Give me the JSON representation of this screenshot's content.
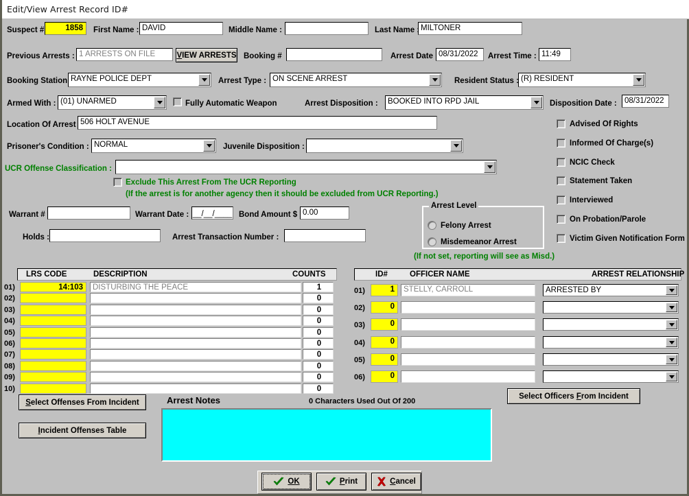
{
  "window": {
    "title": "Edit/View Arrest Record ID#"
  },
  "row_suspect": {
    "suspect_label": "Suspect #",
    "suspect_value": "1858",
    "first_name_label": "First Name :",
    "first_name_value": "DAVID",
    "middle_name_label": "Middle Name :",
    "middle_name_value": "",
    "last_name_label": "Last Name :",
    "last_name_value": "MILTONER"
  },
  "row_prev": {
    "prev_arrests_label": "Previous Arrests :",
    "prev_arrests_value": "1 ARRESTS ON FILE",
    "view_arrests_button": "VIEW ARRESTS",
    "booking_label": "Booking #",
    "booking_value": "",
    "arrest_date_label": "Arrest Date :",
    "arrest_date_value": "08/31/2022",
    "arrest_time_label": "Arrest Time :",
    "arrest_time_value": "11:49"
  },
  "row_booking": {
    "booking_station_label": "Booking Station :",
    "booking_station_value": "RAYNE POLICE DEPT",
    "arrest_type_label": "Arrest Type :",
    "arrest_type_value": "ON SCENE ARREST",
    "resident_status_label": "Resident Status :",
    "resident_status_value": "(R) RESIDENT"
  },
  "row_armed": {
    "armed_with_label": "Armed With :",
    "armed_with_value": "(01) UNARMED",
    "fully_automatic_label": "Fully Automatic Weapon",
    "arrest_disposition_label": "Arrest Disposition :",
    "arrest_disposition_value": "BOOKED INTO  RPD JAIL",
    "disposition_date_label": "Disposition Date :",
    "disposition_date_value": "08/31/2022"
  },
  "row_location": {
    "location_label": "Location Of Arrest :",
    "location_value": "506 HOLT AVENUE"
  },
  "row_condition": {
    "prisoner_condition_label": "Prisoner's Condition :",
    "prisoner_condition_value": "NORMAL",
    "juvenile_disposition_label": "Juvenile Disposition :",
    "juvenile_disposition_value": ""
  },
  "row_ucr": {
    "ucr_label": "UCR Offense Classification :",
    "ucr_value": "",
    "exclude_label": "Exclude This Arrest From The UCR Reporting",
    "exclude_note": "(If the arrest is for another agency then it should be excluded from UCR Reporting.)"
  },
  "row_warrant": {
    "warrant_num_label": "Warrant #",
    "warrant_num_value": "",
    "warrant_date_label": "Warrant Date :",
    "warrant_date_value": "__/__/____",
    "bond_amount_label": "Bond Amount $",
    "bond_amount_value": "0.00",
    "holds_label": "Holds :",
    "holds_value": "",
    "transaction_label": "Arrest Transaction Number :",
    "transaction_value": ""
  },
  "arrest_level": {
    "group_title": "Arrest Level",
    "felony_label": "Felony Arrest",
    "misdemeanor_label": "Misdemeanor Arrest",
    "note": "(If not set, reporting will see as Misd.)"
  },
  "checkboxes": [
    {
      "label": "Advised Of Rights"
    },
    {
      "label": "Informed Of Charge(s)"
    },
    {
      "label": "NCIC Check"
    },
    {
      "label": "Statement Taken"
    },
    {
      "label": "Interviewed"
    },
    {
      "label": "On Probation/Parole"
    },
    {
      "label": "Victim Given Notification Form"
    }
  ],
  "offense_table": {
    "headers": {
      "code": "LRS CODE",
      "description": "DESCRIPTION",
      "counts": "COUNTS"
    },
    "rows": [
      {
        "num": "01)",
        "code": "14:103",
        "description": "DISTURBING THE PEACE",
        "counts": "1"
      },
      {
        "num": "02)",
        "code": "",
        "description": "",
        "counts": "0"
      },
      {
        "num": "03)",
        "code": "",
        "description": "",
        "counts": "0"
      },
      {
        "num": "04)",
        "code": "",
        "description": "",
        "counts": "0"
      },
      {
        "num": "05)",
        "code": "",
        "description": "",
        "counts": "0"
      },
      {
        "num": "06)",
        "code": "",
        "description": "",
        "counts": "0"
      },
      {
        "num": "07)",
        "code": "",
        "description": "",
        "counts": "0"
      },
      {
        "num": "08)",
        "code": "",
        "description": "",
        "counts": "0"
      },
      {
        "num": "09)",
        "code": "",
        "description": "",
        "counts": "0"
      },
      {
        "num": "10)",
        "code": "",
        "description": "",
        "counts": "0"
      }
    ]
  },
  "officer_table": {
    "headers": {
      "id": "ID#",
      "name": "OFFICER NAME",
      "relationship": "ARREST RELATIONSHIP"
    },
    "rows": [
      {
        "num": "01)",
        "id": "1",
        "name": "STELLY, CARROLL",
        "relationship": "ARRESTED BY"
      },
      {
        "num": "02)",
        "id": "0",
        "name": "",
        "relationship": ""
      },
      {
        "num": "03)",
        "id": "0",
        "name": "",
        "relationship": ""
      },
      {
        "num": "04)",
        "id": "0",
        "name": "",
        "relationship": ""
      },
      {
        "num": "05)",
        "id": "0",
        "name": "",
        "relationship": ""
      },
      {
        "num": "06)",
        "id": "0",
        "name": "",
        "relationship": ""
      }
    ]
  },
  "bottom": {
    "select_offenses_button": "Select Offenses From Incident",
    "incident_offenses_button": "Incident Offenses Table",
    "select_officers_button": "Select Officers From Incident",
    "arrest_notes_label": "Arrest Notes",
    "characters_used": "0 Characters Used Out Of 200",
    "notes_value": "",
    "ok_button": "OK",
    "print_button": "Print",
    "cancel_button": "Cancel"
  },
  "colors": {
    "face": "#c0c0c0",
    "highlight_yellow": "#ffff00",
    "notes_cyan": "#00ffff",
    "green_text": "#008000"
  }
}
